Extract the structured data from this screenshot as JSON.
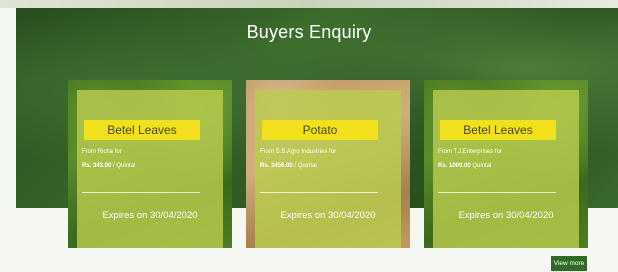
{
  "header": {
    "title": "Buyers Enquiry"
  },
  "cards": [
    {
      "product": "Betel Leaves",
      "from": "From Richa for",
      "price": "Rs. 343.00",
      "unit": " / Quintal",
      "expires": "Expires on 30/04/2020",
      "image": "betel-leaves-photo"
    },
    {
      "product": "Potato",
      "from": "From S.S.Agro Industries for",
      "price": "Rs. 3456.00",
      "unit": " / Quintal",
      "expires": "Expires on 30/04/2020",
      "image": "potato-photo"
    },
    {
      "product": "Betel Leaves",
      "from": "From T.J.Enterprises for",
      "price": "Rs. 1000.00",
      "unit": " Quintal",
      "expires": "Expires on 30/04/2020",
      "image": "betel-leaves-photo"
    }
  ],
  "view_more_label": "View more",
  "colors": {
    "accent_green": "#2f6b24",
    "card_overlay": "#b9cc4e",
    "title_badge": "#f2e01c"
  }
}
